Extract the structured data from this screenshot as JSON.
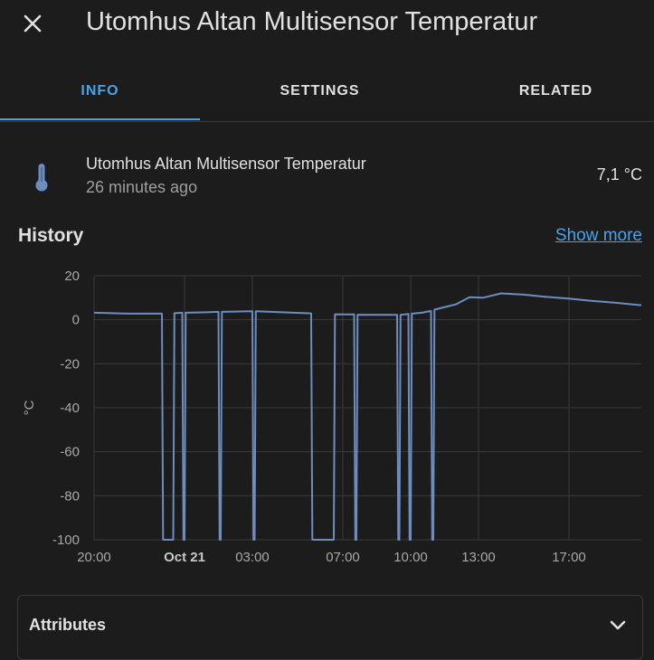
{
  "dialog": {
    "title": "Utomhus Altan Multisensor Temperatur",
    "close_icon": "close-icon"
  },
  "tabs": [
    {
      "label": "INFO",
      "active": true
    },
    {
      "label": "SETTINGS",
      "active": false
    },
    {
      "label": "RELATED",
      "active": false
    }
  ],
  "entity": {
    "icon": "thermometer-icon",
    "name": "Utomhus Altan Multisensor Temperatur",
    "last_changed": "26 minutes ago",
    "state": "7,1 °C"
  },
  "history": {
    "title": "History",
    "show_more": "Show more"
  },
  "chart_data": {
    "type": "line",
    "ylabel": "°C",
    "ylim": [
      -100,
      20
    ],
    "yticks": [
      20,
      0,
      -20,
      -40,
      -60,
      -80,
      -100
    ],
    "xlim": [
      0,
      24.2
    ],
    "xticks": [
      {
        "x": 0,
        "label": "20:00",
        "bold": false
      },
      {
        "x": 4,
        "label": "Oct 21",
        "bold": true
      },
      {
        "x": 7,
        "label": "03:00",
        "bold": false
      },
      {
        "x": 11,
        "label": "07:00",
        "bold": false
      },
      {
        "x": 14,
        "label": "10:00",
        "bold": false
      },
      {
        "x": 17,
        "label": "13:00",
        "bold": false
      },
      {
        "x": 21,
        "label": "17:00",
        "bold": false
      }
    ],
    "grid": true,
    "color": "#6d8dbf",
    "series": [
      {
        "points": [
          [
            0,
            3.2
          ],
          [
            1.5,
            2.8
          ],
          [
            3.0,
            2.8
          ],
          [
            3.05,
            -100
          ],
          [
            3.5,
            -100
          ],
          [
            3.55,
            3.0
          ],
          [
            3.9,
            3.2
          ],
          [
            3.95,
            -100
          ],
          [
            4.0,
            -100
          ],
          [
            4.05,
            3.2
          ],
          [
            5.0,
            3.4
          ],
          [
            5.5,
            3.6
          ],
          [
            5.55,
            -100
          ],
          [
            5.6,
            -100
          ],
          [
            5.65,
            3.6
          ],
          [
            7.0,
            3.9
          ],
          [
            7.05,
            -100
          ],
          [
            7.1,
            -100
          ],
          [
            7.15,
            3.9
          ],
          [
            7.8,
            3.6
          ],
          [
            9.6,
            2.9
          ],
          [
            9.65,
            -100
          ],
          [
            10.6,
            -100
          ],
          [
            10.65,
            2.5
          ],
          [
            11.5,
            2.4
          ],
          [
            11.55,
            -100
          ],
          [
            11.6,
            -100
          ],
          [
            11.65,
            2.3
          ],
          [
            13.4,
            2.2
          ],
          [
            13.45,
            -100
          ],
          [
            13.5,
            -100
          ],
          [
            13.55,
            2.2
          ],
          [
            13.9,
            2.6
          ],
          [
            13.95,
            -100
          ],
          [
            14.0,
            -100
          ],
          [
            14.05,
            2.8
          ],
          [
            14.5,
            3.2
          ],
          [
            14.9,
            4.0
          ],
          [
            14.95,
            -100
          ],
          [
            15.0,
            -100
          ],
          [
            15.05,
            4.6
          ],
          [
            16.0,
            7.0
          ],
          [
            16.6,
            10.2
          ],
          [
            17.2,
            10.0
          ],
          [
            18.0,
            12.0
          ],
          [
            19.0,
            11.4
          ],
          [
            20.0,
            10.4
          ],
          [
            21.0,
            9.6
          ],
          [
            22.0,
            8.6
          ],
          [
            23.0,
            7.8
          ],
          [
            24.2,
            6.6
          ]
        ]
      }
    ]
  },
  "attributes": {
    "label": "Attributes",
    "icon": "chevron-down-icon"
  }
}
